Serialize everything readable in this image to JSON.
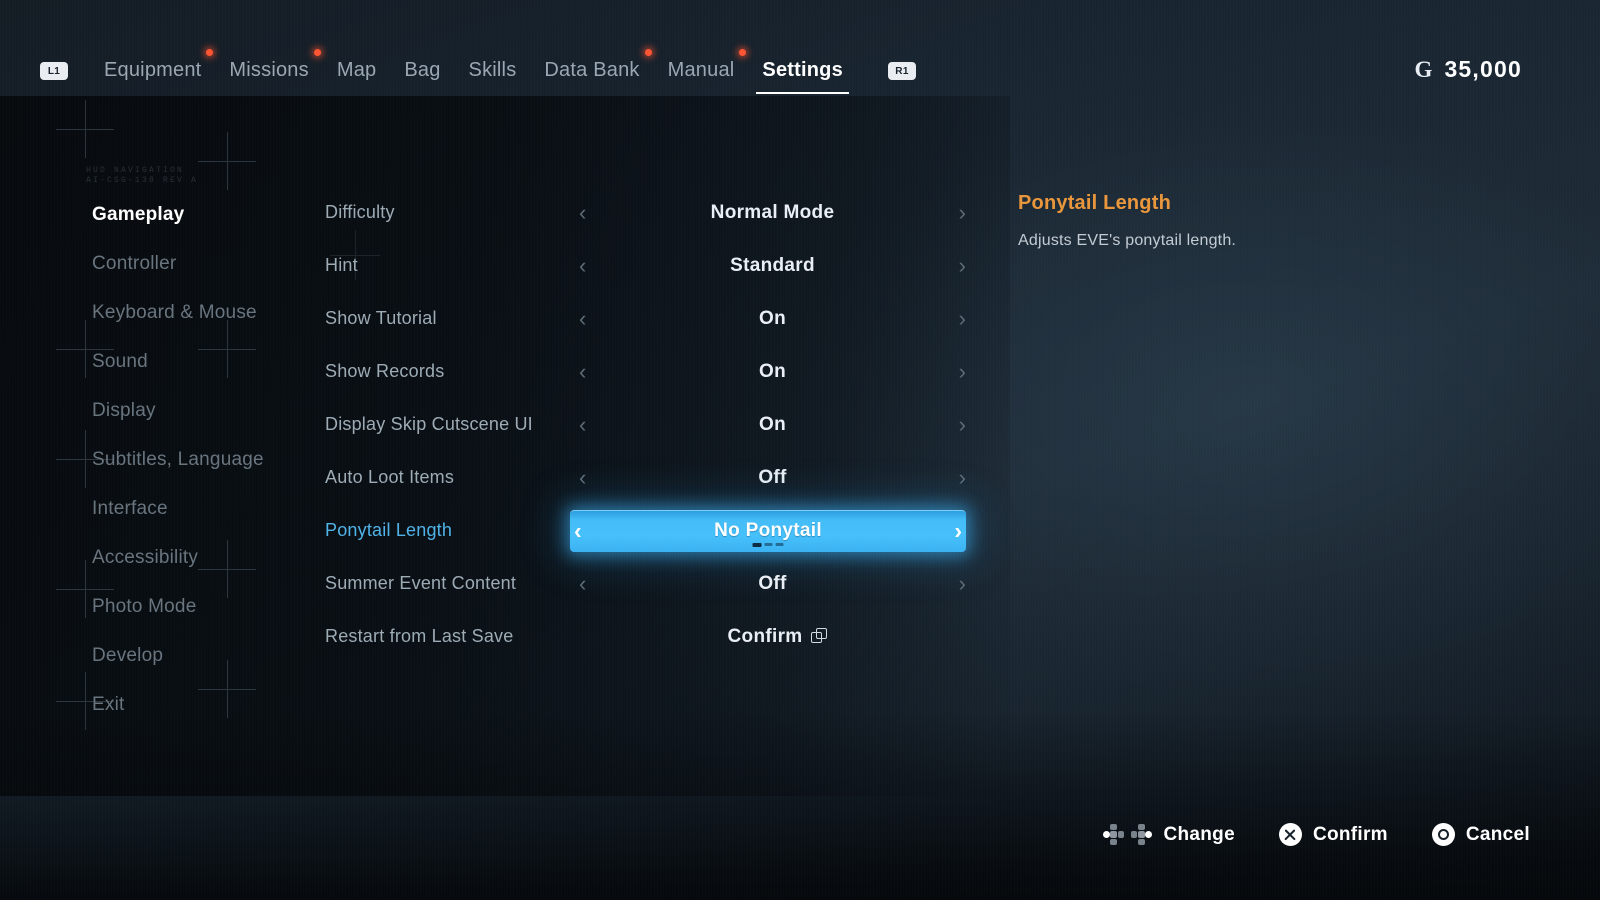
{
  "topnav": {
    "bumper_left": "L1",
    "bumper_right": "R1",
    "tabs": [
      {
        "label": "Equipment",
        "active": false,
        "dot": true
      },
      {
        "label": "Missions",
        "active": false,
        "dot": true
      },
      {
        "label": "Map",
        "active": false,
        "dot": false
      },
      {
        "label": "Bag",
        "active": false,
        "dot": false
      },
      {
        "label": "Skills",
        "active": false,
        "dot": false
      },
      {
        "label": "Data Bank",
        "active": false,
        "dot": true
      },
      {
        "label": "Manual",
        "active": false,
        "dot": true
      },
      {
        "label": "Settings",
        "active": true,
        "dot": false
      }
    ]
  },
  "currency": {
    "symbol": "G",
    "amount": "35,000"
  },
  "hud_marks": [
    "HUD NAVIGATION",
    "AI-CSG-138 REV A"
  ],
  "sidebar": {
    "items": [
      {
        "label": "Gameplay",
        "active": true
      },
      {
        "label": "Controller",
        "active": false
      },
      {
        "label": "Keyboard & Mouse",
        "active": false
      },
      {
        "label": "Sound",
        "active": false
      },
      {
        "label": "Display",
        "active": false
      },
      {
        "label": "Subtitles, Language",
        "active": false
      },
      {
        "label": "Interface",
        "active": false
      },
      {
        "label": "Accessibility",
        "active": false
      },
      {
        "label": "Photo Mode",
        "active": false
      },
      {
        "label": "Develop",
        "active": false
      },
      {
        "label": "Exit",
        "active": false
      }
    ]
  },
  "settings": {
    "rows": [
      {
        "label": "Difficulty",
        "value": "Normal Mode",
        "type": "stepper",
        "selected": false
      },
      {
        "label": "Hint",
        "value": "Standard",
        "type": "stepper",
        "selected": false
      },
      {
        "label": "Show Tutorial",
        "value": "On",
        "type": "stepper",
        "selected": false
      },
      {
        "label": "Show Records",
        "value": "On",
        "type": "stepper",
        "selected": false
      },
      {
        "label": "Display Skip Cutscene UI",
        "value": "On",
        "type": "stepper",
        "selected": false
      },
      {
        "label": "Auto Loot Items",
        "value": "Off",
        "type": "stepper",
        "selected": false
      },
      {
        "label": "Ponytail Length",
        "value": "No Ponytail",
        "type": "stepper",
        "selected": true,
        "steps": 3,
        "step_index": 0
      },
      {
        "label": "Summer Event Content",
        "value": "Off",
        "type": "stepper",
        "selected": false
      },
      {
        "label": "Restart from Last Save",
        "value": "Confirm",
        "type": "action",
        "selected": false,
        "icon": "restart-windows-icon"
      }
    ],
    "chevron_left": "‹",
    "chevron_right": "›"
  },
  "info": {
    "title": "Ponytail Length",
    "description": "Adjusts EVE's ponytail length."
  },
  "actionbar": {
    "actions": [
      {
        "label": "Change",
        "icon": "dpad-left-right-icon"
      },
      {
        "label": "Confirm",
        "icon": "cross-button-icon"
      },
      {
        "label": "Cancel",
        "icon": "circle-button-icon"
      }
    ]
  },
  "colors": {
    "highlight": "#46c0fb",
    "accent_orange": "#e9963c",
    "notification_dot": "#ff5533",
    "selected_label": "#4fb3e8"
  }
}
